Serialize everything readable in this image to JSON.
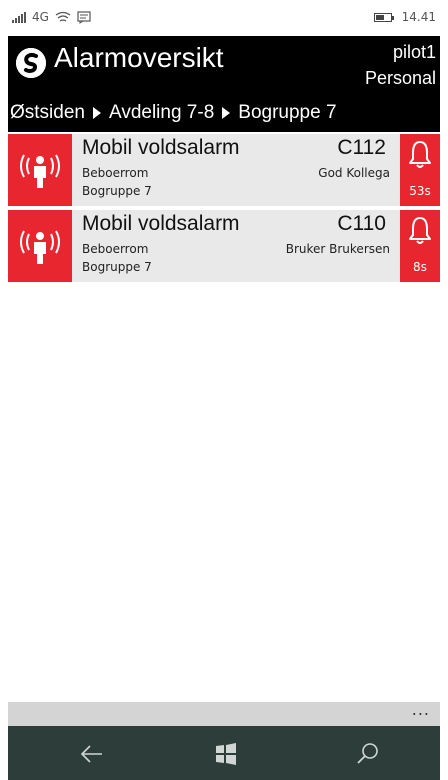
{
  "status_bar": {
    "network": "4G",
    "time": "14.41",
    "icons": [
      "signal-icon",
      "wifi-icon",
      "message-icon",
      "battery-icon"
    ]
  },
  "header": {
    "app_title": "Alarmoversikt",
    "user_name": "pilot1",
    "user_role": "Personal",
    "breadcrumb": [
      "Østsiden",
      "Avdeling 7-8",
      "Bogruppe 7"
    ]
  },
  "alarms": [
    {
      "title": "Mobil voldsalarm",
      "code": "C112",
      "room": "Beboerrom",
      "person": "God Kollega",
      "group": "Bogruppe 7",
      "timer": "53s"
    },
    {
      "title": "Mobil voldsalarm",
      "code": "C110",
      "room": "Beboerrom",
      "person": "Bruker Brukersen",
      "group": "Bogruppe 7",
      "timer": "8s"
    }
  ],
  "app_bar": {
    "more_label": "..."
  },
  "colors": {
    "alarm_red": "#e8262f",
    "header_bg": "#000000",
    "nav_bg": "#2c3d3a",
    "item_bg": "#e9e9e9"
  }
}
